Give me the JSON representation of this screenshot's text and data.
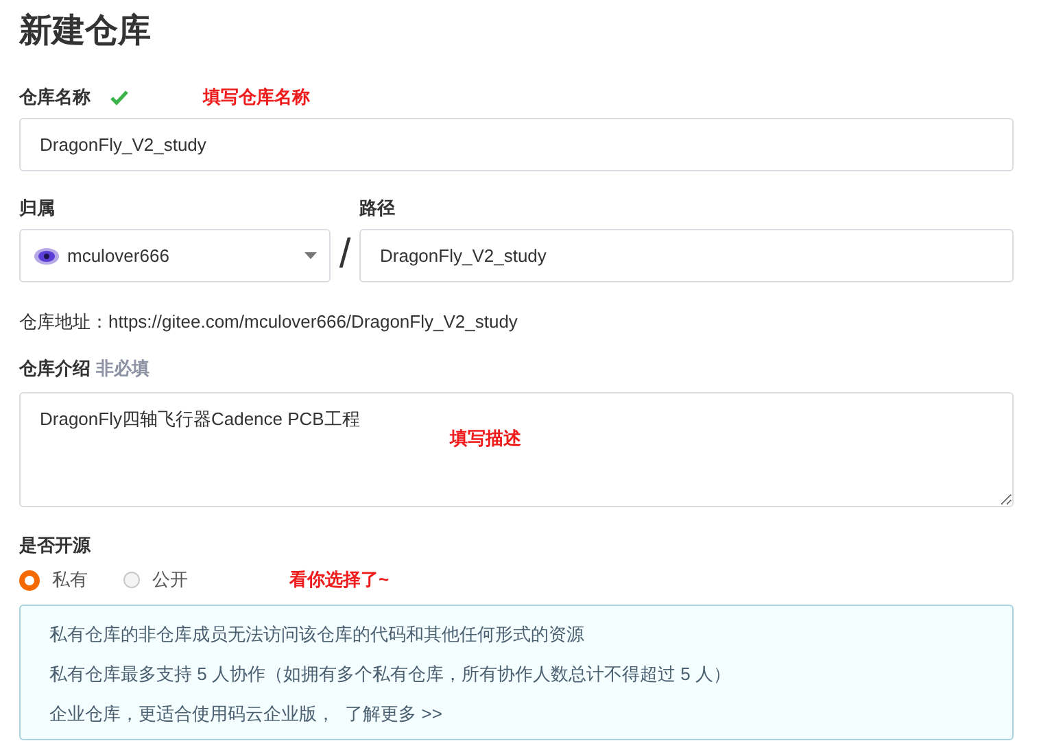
{
  "title": "新建仓库",
  "name_field": {
    "label": "仓库名称",
    "valid": true,
    "annotation": "填写仓库名称",
    "value": "DragonFly_V2_study"
  },
  "owner": {
    "label": "归属",
    "value": "mculover666"
  },
  "separator": "/",
  "path": {
    "label": "路径",
    "value": "DragonFly_V2_study"
  },
  "address": "仓库地址：https://gitee.com/mculover666/DragonFly_V2_study",
  "intro": {
    "label": "仓库介绍",
    "hint": "非必填",
    "value": "DragonFly四轴飞行器Cadence PCB工程",
    "annotation": "填写描述"
  },
  "visibility": {
    "label": "是否开源",
    "annotation": "看你选择了~",
    "options": [
      {
        "label": "私有",
        "selected": true
      },
      {
        "label": "公开",
        "selected": false
      }
    ]
  },
  "info": {
    "lines": [
      "私有仓库的非仓库成员无法访问该仓库的代码和其他任何形式的资源",
      "私有仓库最多支持 5 人协作（如拥有多个私有仓库，所有协作人数总计不得超过 5 人）"
    ],
    "last_line": "企业仓库，更适合使用码云企业版，",
    "link": "了解更多 >>"
  }
}
